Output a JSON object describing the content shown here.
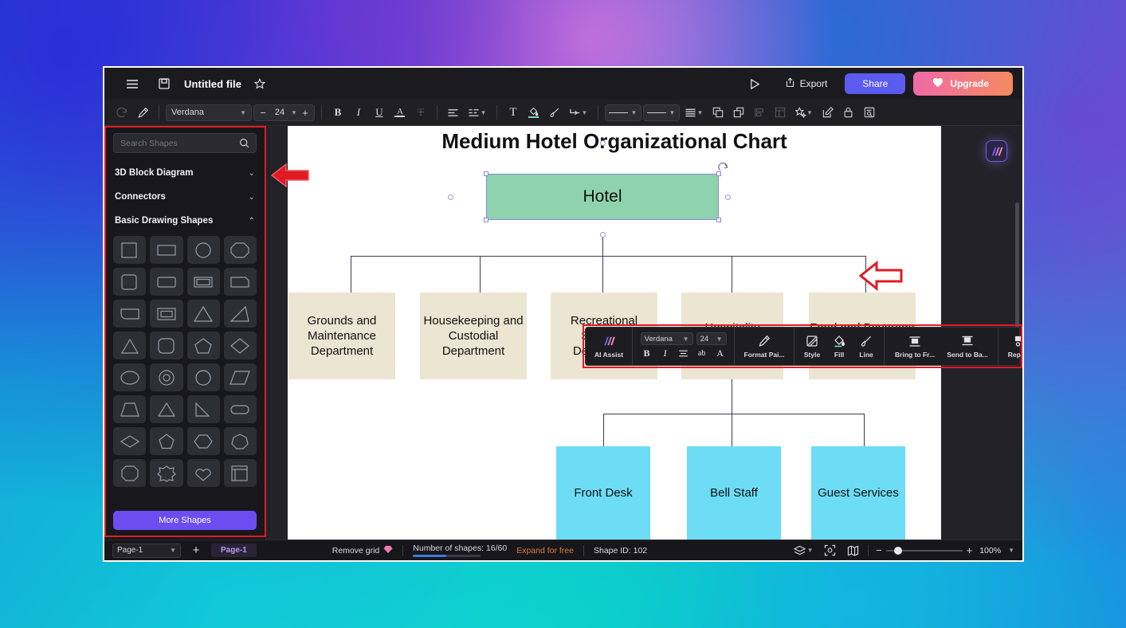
{
  "titlebar": {
    "menu_icon": "hamburger-menu-icon",
    "save_icon": "save-icon",
    "title": "Untitled file",
    "favorite_icon": "star-icon",
    "present_label": "present-icon",
    "export_label": "Export",
    "share_label": "Share",
    "upgrade_label": "Upgrade"
  },
  "format_toolbar": {
    "redo_icon": "redo-icon",
    "format_painter_icon": "format-painter-icon",
    "font_family": "Verdana",
    "font_size": "24",
    "decrease_label": "−",
    "increase_label": "+",
    "bold_label": "B",
    "italic_label": "I",
    "underline_label": "U",
    "font_color_label": "A",
    "strikethrough_label": "T",
    "align_icon": "align-left-icon",
    "text_options_icon": "text-options-icon",
    "text_box_label": "T",
    "fill_icon": "fill-bucket-icon",
    "line_style_icon": "brush-icon",
    "connector_icon": "connector-icon",
    "line_weight_icon": "line-weight-icon",
    "line_color_icon": "line-color-icon",
    "list_icon": "list-icon",
    "bring_front_icon": "bring-to-front-icon",
    "send_back_icon": "send-to-back-icon",
    "distribute_icon": "distribute-icon",
    "table_icon": "table-icon",
    "effects_icon": "effects-icon",
    "edit_icon": "edit-icon",
    "lock_icon": "lock-icon",
    "notes_icon": "notes-icon"
  },
  "shapes_panel": {
    "search_placeholder": "Search Shapes",
    "search_value": "",
    "search_icon": "search-icon",
    "categories": [
      {
        "label": "3D Block Diagram",
        "expanded": false,
        "chevron": "⌄"
      },
      {
        "label": "Connectors",
        "expanded": false,
        "chevron": "⌄"
      },
      {
        "label": "Basic Drawing Shapes",
        "expanded": true,
        "chevron": "⌃"
      }
    ],
    "shapes": [
      "square",
      "rectangle",
      "circle",
      "octagon",
      "rounded-square",
      "rounded-rectangle",
      "rect-inner",
      "rounded-rect-2",
      "rounded-left-rect",
      "nested-rect",
      "triangle",
      "right-triangle",
      "triangle-2",
      "rounded-square-2",
      "pentagon",
      "diamond",
      "ellipse",
      "donut",
      "circle-in-square",
      "parallelogram",
      "trapezoid",
      "triangle-3",
      "diagonal-line",
      "stadium",
      "rhombus",
      "pentagon-2",
      "hexagon",
      "heptagon",
      "octagon-2",
      "star-burst",
      "cloud",
      "corner-frame"
    ],
    "more_shapes_label": "More Shapes"
  },
  "context_toolbar": {
    "ai_assist_label": "AI Assist",
    "ai_assist_icon": "ai-sparkle-icon",
    "font_family": "Verdana",
    "font_size": "24",
    "bold_label": "B",
    "italic_label": "I",
    "align_icon": "align-icon",
    "case_label": "ab",
    "font_color_label": "A",
    "items": [
      {
        "label": "Format Pai...",
        "icon": "format-painter-icon"
      },
      {
        "label": "Style",
        "icon": "style-icon"
      },
      {
        "label": "Fill",
        "icon": "fill-bucket-icon"
      },
      {
        "label": "Line",
        "icon": "line-brush-icon"
      },
      {
        "label": "Bring to Fr...",
        "icon": "bring-to-front-icon"
      },
      {
        "label": "Send to Ba...",
        "icon": "send-to-back-icon"
      },
      {
        "label": "Replace",
        "icon": "replace-shape-icon"
      }
    ]
  },
  "canvas": {
    "ai_fab_icon": "ai-logo-icon",
    "chart_title": "Medium Hotel Organizational Chart"
  },
  "statusbar": {
    "page_select_value": "Page-1",
    "add_page_icon": "plus-icon",
    "page_tab_label": "Page-1",
    "remove_grid_label": "Remove grid",
    "remove_grid_icon": "diamond-gem-icon",
    "shape_count_label": "Number of shapes: 16/60",
    "expand_free_label": "Expand for free",
    "shape_id_label": "Shape ID: 102",
    "layers_icon": "layers-icon",
    "focus_icon": "focus-icon",
    "map_icon": "minimap-icon",
    "zoom_minus": "−",
    "zoom_plus": "+",
    "zoom_value": "100%"
  },
  "annotations": {
    "arrow_sidebar": "red-left-arrow",
    "arrow_context_toolbar": "red-left-arrow"
  },
  "chart_data": {
    "type": "diagram",
    "title": "Medium Hotel Organizational Chart",
    "root": {
      "label": "Hotel",
      "color": "#8ed3ad",
      "selected": true
    },
    "departments": [
      {
        "label": "Grounds and Maintenance Department",
        "color": "#ece5d2"
      },
      {
        "label": "Housekeeping and Custodial Department",
        "color": "#ece5d2"
      },
      {
        "label": "Recreational Services Department",
        "color": "#ece5d2"
      },
      {
        "label": "Hospitality Department",
        "color": "#ece5d2"
      },
      {
        "label": "Food and Beverage Department",
        "color": "#ece5d2"
      }
    ],
    "leaves": [
      {
        "label": "Front Desk",
        "parent": "Hospitality Department",
        "color": "#6ddcf5"
      },
      {
        "label": "Bell Staff",
        "parent": "Hospitality Department",
        "color": "#6ddcf5"
      },
      {
        "label": "Guest Services",
        "parent": "Hospitality Department",
        "color": "#6ddcf5"
      }
    ]
  }
}
